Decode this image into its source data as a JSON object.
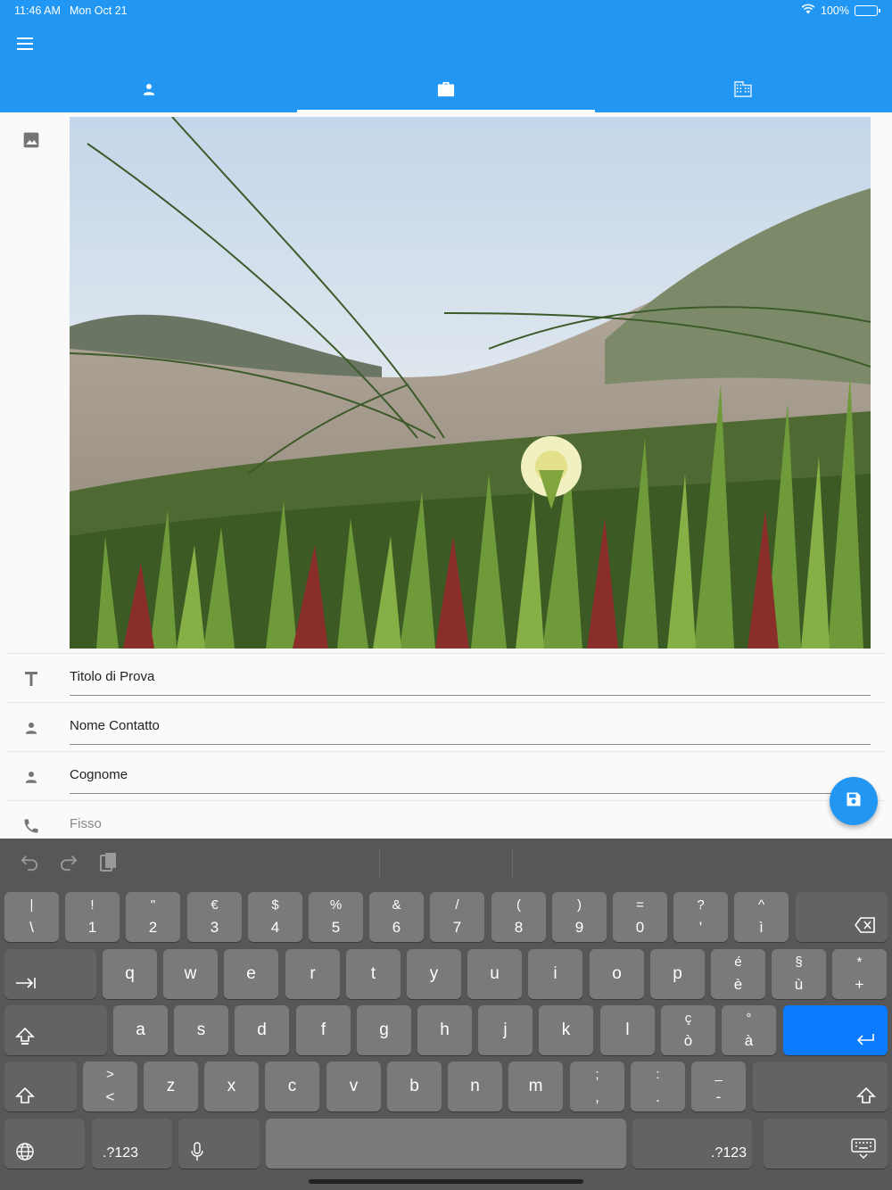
{
  "status_bar": {
    "time": "11:46 AM",
    "date": "Mon Oct 21",
    "battery": "100%"
  },
  "header": {
    "tabs": [
      {
        "name": "person",
        "icon": "person-icon",
        "active": false
      },
      {
        "name": "work",
        "icon": "briefcase-icon",
        "active": true
      },
      {
        "name": "company",
        "icon": "building-icon",
        "active": false
      }
    ],
    "colors": {
      "primary": "#2196f3",
      "accent": "#ffffff"
    }
  },
  "form": {
    "fields": [
      {
        "icon": "title-icon",
        "value": "Titolo di Prova",
        "placeholder": ""
      },
      {
        "icon": "person-icon",
        "value": "Nome Contatto",
        "placeholder": ""
      },
      {
        "icon": "person-icon",
        "value": "Cognome",
        "placeholder": ""
      },
      {
        "icon": "phone-icon",
        "value": "",
        "placeholder": "Fisso"
      }
    ]
  },
  "keyboard": {
    "row1": [
      {
        "top": "|",
        "bot": "\\"
      },
      {
        "top": "!",
        "bot": "1"
      },
      {
        "top": "\"",
        "bot": "2"
      },
      {
        "top": "€",
        "bot": "3"
      },
      {
        "top": "$",
        "bot": "4"
      },
      {
        "top": "%",
        "bot": "5"
      },
      {
        "top": "&",
        "bot": "6"
      },
      {
        "top": "/",
        "bot": "7"
      },
      {
        "top": "(",
        "bot": "8"
      },
      {
        "top": ")",
        "bot": "9"
      },
      {
        "top": "=",
        "bot": "0"
      },
      {
        "top": "?",
        "bot": "'"
      },
      {
        "top": "^",
        "bot": "ì"
      }
    ],
    "row2": [
      "q",
      "w",
      "e",
      "r",
      "t",
      "y",
      "u",
      "i",
      "o",
      "p"
    ],
    "row2_extra": [
      {
        "top": "é",
        "bot": "è"
      },
      {
        "top": "§",
        "bot": "ù"
      },
      {
        "top": "*",
        "bot": "+"
      }
    ],
    "row3": [
      "a",
      "s",
      "d",
      "f",
      "g",
      "h",
      "j",
      "k",
      "l"
    ],
    "row3_extra": [
      {
        "top": "ç",
        "bot": "ò"
      },
      {
        "top": "°",
        "bot": "à"
      }
    ],
    "row4_first": {
      "top": ">",
      "bot": "<"
    },
    "row4": [
      "z",
      "x",
      "c",
      "v",
      "b",
      "n",
      "m"
    ],
    "row4_extra": [
      {
        "top": ";",
        "bot": ","
      },
      {
        "top": ":",
        "bot": "."
      },
      {
        "top": "_",
        "bot": "-"
      }
    ],
    "numbers_label": ".?123"
  }
}
